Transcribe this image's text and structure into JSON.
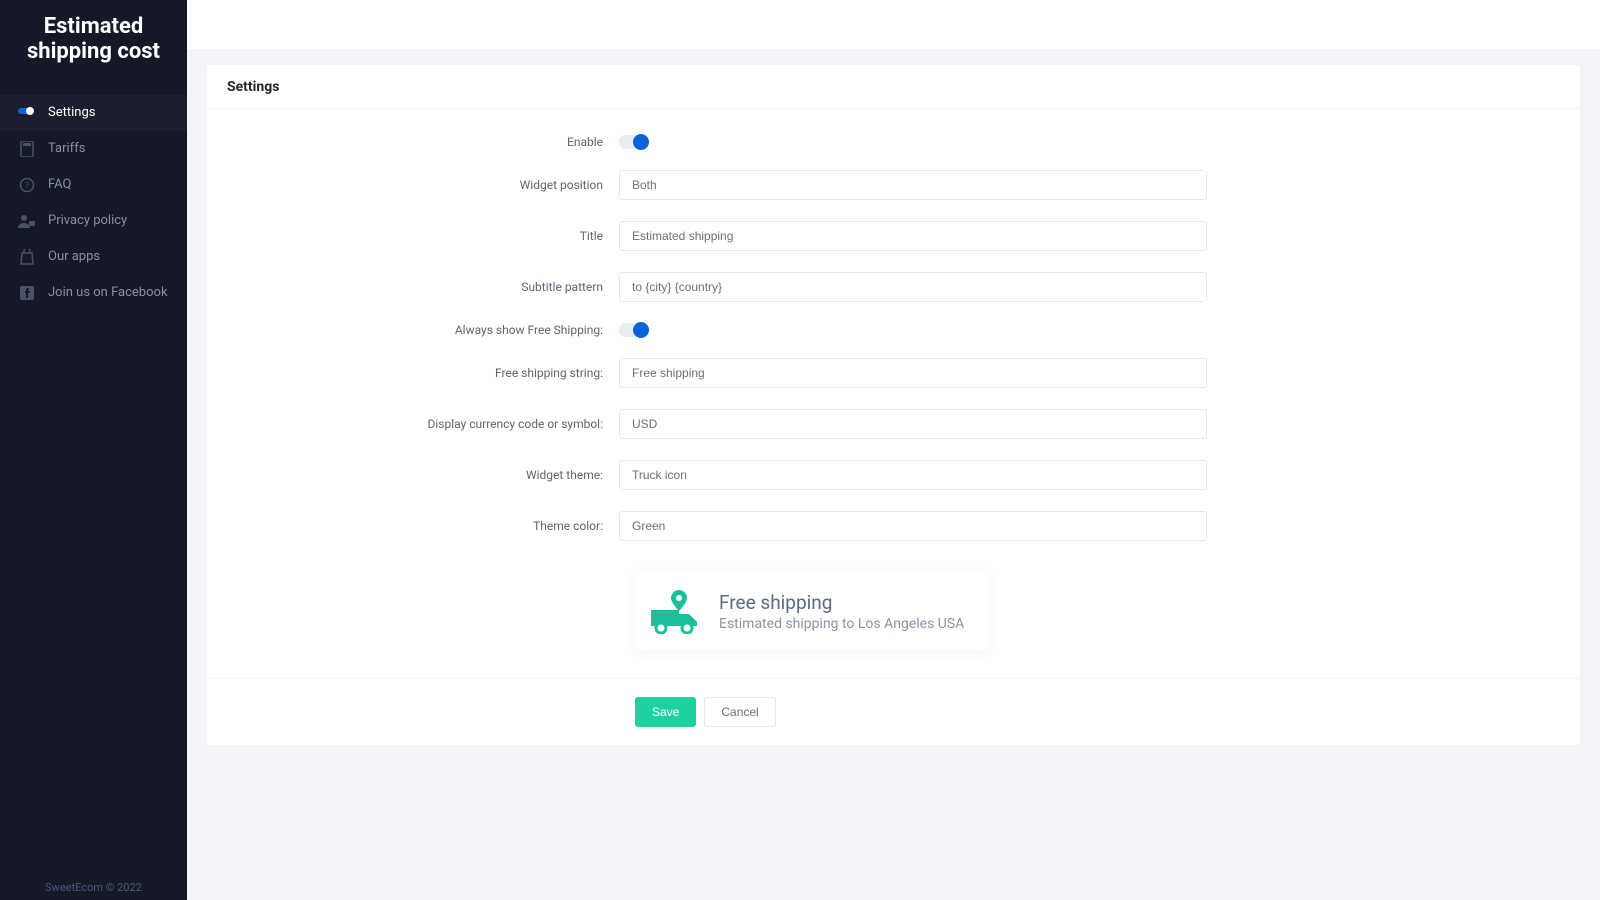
{
  "app": {
    "title_line1": "Estimated",
    "title_line2": "shipping cost",
    "footer": "SweetEcom © 2022"
  },
  "sidebar": {
    "items": [
      {
        "label": "Settings"
      },
      {
        "label": "Tariffs"
      },
      {
        "label": "FAQ"
      },
      {
        "label": "Privacy policy"
      },
      {
        "label": "Our apps"
      },
      {
        "label": "Join us on Facebook"
      }
    ]
  },
  "page": {
    "heading": "Settings"
  },
  "form": {
    "enable_label": "Enable",
    "enable_value": true,
    "widget_position_label": "Widget position",
    "widget_position_value": "Both",
    "title_label": "Title",
    "title_value": "Estimated shipping",
    "subtitle_pattern_label": "Subtitle pattern",
    "subtitle_pattern_value": "to {city} {country}",
    "always_free_label": "Always show Free Shipping:",
    "always_free_value": true,
    "free_shipping_string_label": "Free shipping string:",
    "free_shipping_string_value": "Free shipping",
    "currency_label": "Display currency code or symbol:",
    "currency_value": "USD",
    "widget_theme_label": "Widget theme:",
    "widget_theme_value": "Truck icon",
    "theme_color_label": "Theme color:",
    "theme_color_value": "Green"
  },
  "preview": {
    "title": "Free shipping",
    "subtitle": "Estimated shipping to Los Angeles USA",
    "accent": "#1dbf9b"
  },
  "buttons": {
    "save": "Save",
    "cancel": "Cancel"
  }
}
